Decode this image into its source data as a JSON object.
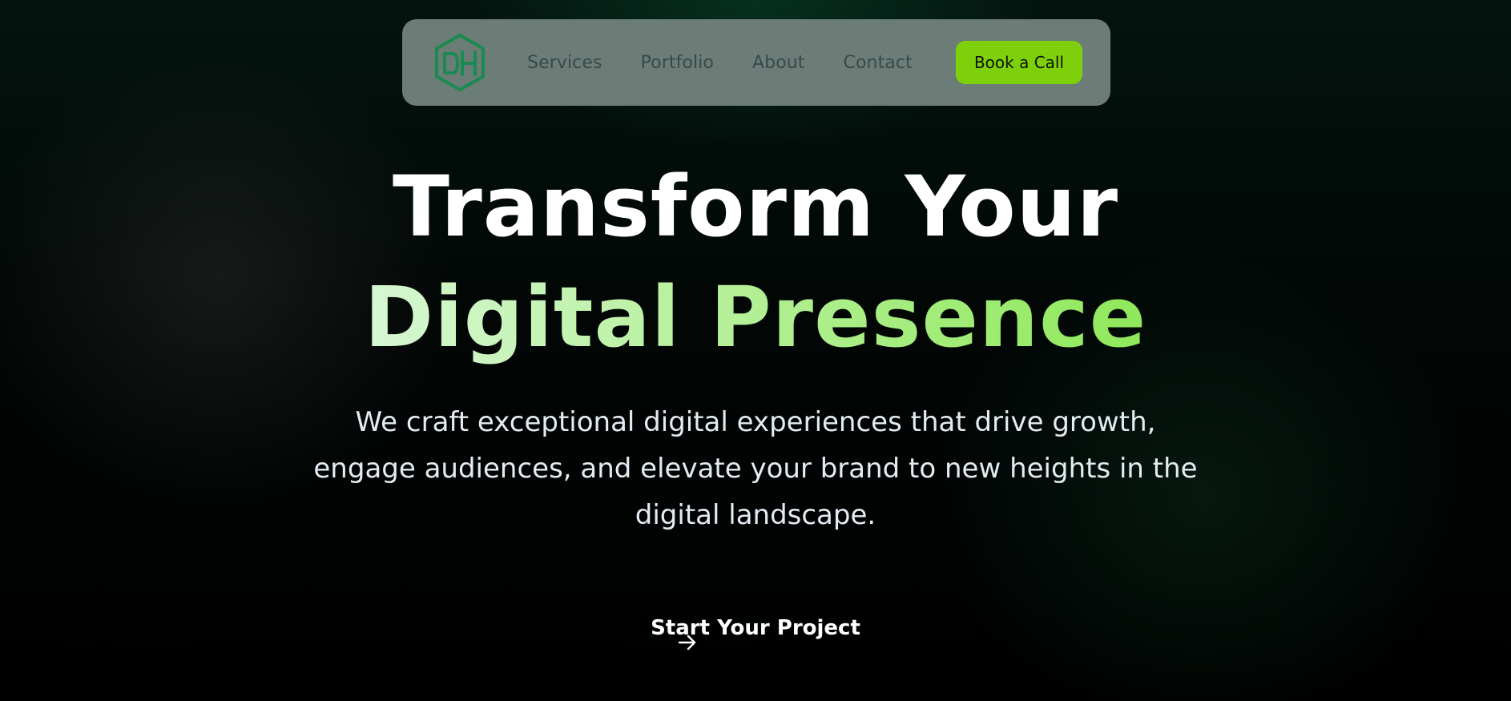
{
  "nav": {
    "logo_icon": "dh-hexagon-logo",
    "links": [
      {
        "label": "Services"
      },
      {
        "label": "Portfolio"
      },
      {
        "label": "About"
      },
      {
        "label": "Contact"
      }
    ],
    "cta_label": "Book a Call"
  },
  "hero": {
    "title_line1": "Transform Your",
    "title_line2": "Digital Presence",
    "subtitle": "We craft exceptional digital experiences that drive growth, engage audiences, and elevate your brand to new heights in the digital landscape.",
    "cta_label": "Start Your Project",
    "cta_icon": "arrow-right-icon"
  },
  "colors": {
    "nav_background": "#6b7d76",
    "nav_link": "#37494c",
    "accent_green": "#7ed10a",
    "logo_green": "#1a8a52",
    "gradient_start": "#d6f7d3",
    "gradient_end": "#8fe85a"
  }
}
